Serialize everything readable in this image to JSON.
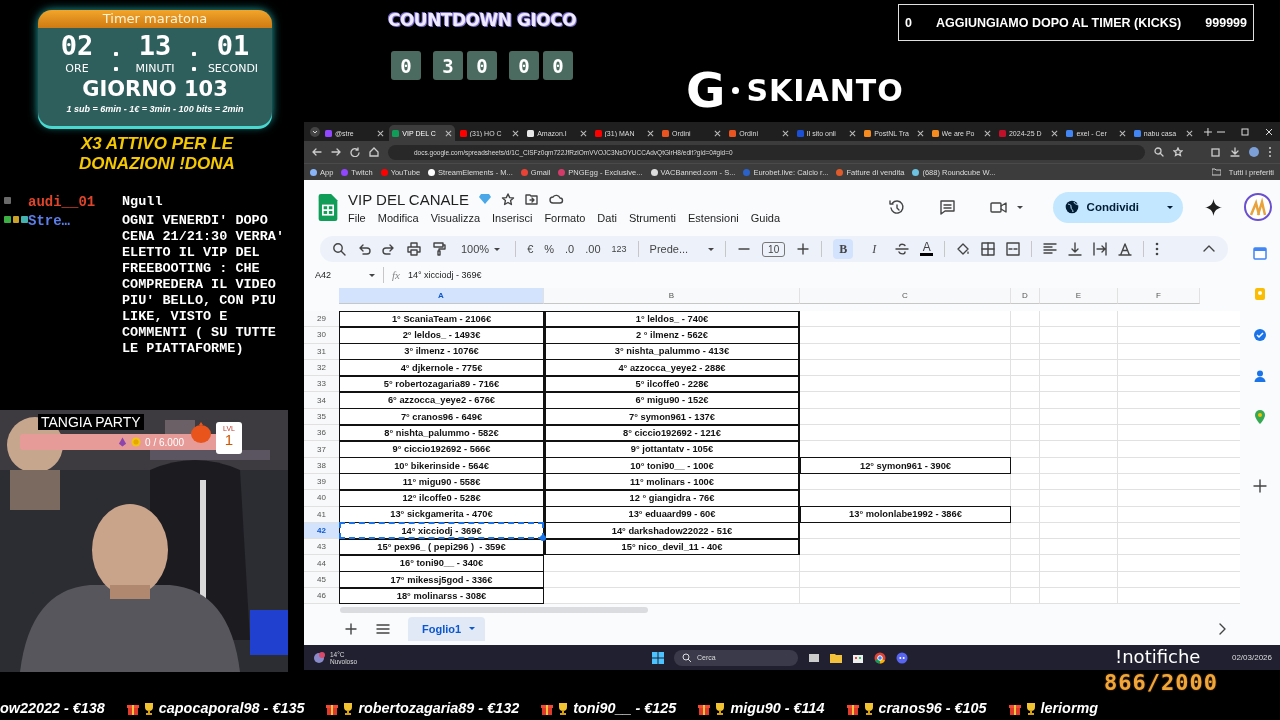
{
  "timer": {
    "title": "Timer maratona",
    "hours": "02",
    "minutes": "13",
    "seconds": "01",
    "labels": [
      "ORE",
      "MINUTI",
      "SECONDI"
    ],
    "day": "GIORNO 103",
    "rates": "1 sub = 6min - 1€ = 3min - 100 bits = 2min"
  },
  "promo": "X3 ATTIVO PER LE DONAZIONI !DONA",
  "chat": [
    {
      "user": "audi__01",
      "color": "#e0442a",
      "badges": [
        {
          "color": "#6a6a6a"
        }
      ],
      "message": "Ngull"
    },
    {
      "user": "Stre…",
      "color": "#5b7ee8",
      "badges": [
        {
          "color": "#3cb043"
        },
        {
          "color": "#c9a227"
        },
        {
          "color": "#44b3b0"
        }
      ],
      "message": "OGNI VENERDI' DOPO CENA 21/21:30 VERRA' ELETTO IL VIP DEL FREEBOOTING : CHE COMPREDERA IL VIDEO PIU' BELLO, CON PIU LIKE, VISTO E COMMENTI ( SU TUTTE LE PIATTAFORME)"
    }
  ],
  "tangia": {
    "title": "TANGIA PARTY",
    "progress": {
      "text": "0 / 6.000",
      "level": 0
    },
    "level_label": "LVL",
    "level_number": "1"
  },
  "countdown": {
    "title": "COUNTDOWN GIOCO",
    "groups": [
      [
        "0"
      ],
      [
        "3",
        "0"
      ],
      [
        "0",
        "0"
      ]
    ]
  },
  "logo": {
    "mark": "G",
    "name": "SKIANTO"
  },
  "kicks": {
    "count": "0",
    "label": "AGGIUNGIAMO DOPO AL TIMER (KICKS)",
    "limit": "999999"
  },
  "browser": {
    "tabs": [
      {
        "label": "@stre",
        "color": "#9146ff",
        "selected": false
      },
      {
        "label": "VIP DEL C",
        "color": "#0f9d58",
        "selected": true
      },
      {
        "label": "(31) HO C",
        "color": "#ff0000",
        "selected": false
      },
      {
        "label": "Amazon.I",
        "color": "#e8e8e8",
        "selected": false
      },
      {
        "label": "(31) MAN",
        "color": "#ff0000",
        "selected": false
      },
      {
        "label": "Ordini",
        "color": "#e95420",
        "selected": false
      },
      {
        "label": "Ordini",
        "color": "#e95420",
        "selected": false
      },
      {
        "label": "Il sito onli",
        "color": "#1a4fd6",
        "selected": false
      },
      {
        "label": "PostNL Tra",
        "color": "#f68b1f",
        "selected": false
      },
      {
        "label": "We are Po",
        "color": "#f68b1f",
        "selected": false
      },
      {
        "label": "2024-25 D",
        "color": "#c0102a",
        "selected": false
      },
      {
        "label": "exel - Cer",
        "color": "#4285f4",
        "selected": false
      },
      {
        "label": "nabu casa",
        "color": "#4285f4",
        "selected": false
      }
    ],
    "url": "docs.google.com/spreadsheets/d/1C_ClSFz0qm722JfRzlOmVVOJC3NsOYUCCAdvQtGlrH8/edit?gid=0#gid=0",
    "bookmarks": [
      {
        "label": "App",
        "color": "#8ab4f8"
      },
      {
        "label": "Twitch",
        "color": "#9146ff"
      },
      {
        "label": "YouTube",
        "color": "#ff0000"
      },
      {
        "label": "StreamElements - M...",
        "color": "#ffffff"
      },
      {
        "label": "Gmail",
        "color": "#ea4335"
      },
      {
        "label": "PNGEgg - Exclusive...",
        "color": "#d33b6b"
      },
      {
        "label": "VACBanned.com - S...",
        "color": "#dddddd"
      },
      {
        "label": "Eurobet.live: Calcio r...",
        "color": "#2a62c9"
      },
      {
        "label": "Fatture di vendita",
        "color": "#e05b2b"
      },
      {
        "label": "(688) Roundcube W...",
        "color": "#6cc2e0"
      }
    ],
    "all_bookmarks": "Tutti i preferiti"
  },
  "sheet": {
    "title": "VIP DEL CANALE",
    "menu": [
      "File",
      "Modifica",
      "Visualizza",
      "Inserisci",
      "Formato",
      "Dati",
      "Strumenti",
      "Estensioni",
      "Guida"
    ],
    "share": "Condividi",
    "toolbar": {
      "zoom": "100%",
      "currency": "€",
      "percent": "%",
      "decimal_less": ".0",
      "decimal_more": ".00",
      "number_format": "123",
      "font": "Prede...",
      "font_size": "10",
      "bold": {
        "label": "B",
        "selected": true
      },
      "italic": {
        "label": "I",
        "selected": false
      },
      "text_color": "A"
    },
    "cell_ref": "A42",
    "fx": "fx",
    "formula": "14° xicciodj - 369€",
    "columns": [
      {
        "label": "A",
        "selected": true
      },
      {
        "label": "B",
        "selected": false
      },
      {
        "label": "C",
        "selected": false
      },
      {
        "label": "D",
        "selected": false
      },
      {
        "label": "E",
        "selected": false
      },
      {
        "label": "F",
        "selected": false
      }
    ],
    "rows": [
      {
        "n": "29",
        "selected": false,
        "a": "1° ScaniaTeam - 2106€",
        "b": "1° leldos_ - 740€"
      },
      {
        "n": "30",
        "selected": false,
        "a": "2° leldos_ - 1493€",
        "b": "2 ° ilmenz - 562€"
      },
      {
        "n": "31",
        "selected": false,
        "a": "3° ilmenz - 1076€",
        "b": "3° nishta_palummo - 413€"
      },
      {
        "n": "32",
        "selected": false,
        "a": "4° djkernole - 775€",
        "b": "4° azzocca_yeye2 - 288€"
      },
      {
        "n": "33",
        "selected": false,
        "a": "5° robertozagaria89 - 716€",
        "b": "5° ilcoffe0 - 228€"
      },
      {
        "n": "34",
        "selected": false,
        "a": "6° azzocca_yeye2 - 676€",
        "b": "6° migu90 - 152€"
      },
      {
        "n": "35",
        "selected": false,
        "a": "7° cranos96 - 649€",
        "b": "7° symon961 - 137€"
      },
      {
        "n": "36",
        "selected": false,
        "a": "8° nishta_palummo - 582€",
        "b": "8° ciccio192692 - 121€"
      },
      {
        "n": "37",
        "selected": false,
        "a": "9° ciccio192692 - 566€",
        "b": "9° jottantatv - 105€"
      },
      {
        "n": "38",
        "selected": false,
        "a": "10° bikerinside - 564€",
        "b": "10° toni90__ - 100€",
        "c": "12° symon961 - 390€"
      },
      {
        "n": "39",
        "selected": false,
        "a": "11° migu90 - 558€",
        "b": "11° molinars - 100€"
      },
      {
        "n": "40",
        "selected": false,
        "a": "12° ilcoffe0 - 528€",
        "b": "12 ° giangidra - 76€"
      },
      {
        "n": "41",
        "selected": false,
        "a": "13° sickgamerita - 470€",
        "b": "13° eduaard99 - 60€",
        "c": "13° molonlabe1992 - 386€"
      },
      {
        "n": "42",
        "selected": true,
        "a": "14° xicciodj - 369€",
        "b": "14° darkshadow22022 - 51€"
      },
      {
        "n": "43",
        "selected": false,
        "a": "15° pex96_ ( pepi296 )  - 359€",
        "b": "15° nico_devil_11 - 40€"
      },
      {
        "n": "44",
        "selected": false,
        "a": "16° toni90__ - 340€"
      },
      {
        "n": "45",
        "selected": false,
        "a": "17° mikessj5god - 336€"
      },
      {
        "n": "46",
        "selected": false,
        "a": "18° molinarss - 308€"
      }
    ],
    "sheet_tabs": [
      {
        "label": "Foglio1",
        "selected": true
      }
    ]
  },
  "taskbar": {
    "temperature": "14°C",
    "weather": "Nuvoloso",
    "search": "Cerca",
    "date": "02/03/2026"
  },
  "notifications": "!notifiche",
  "goal": "866/2000",
  "ticker": [
    {
      "kind": "partial",
      "text": "ow22022 - €138"
    },
    {
      "kind": "entry",
      "text": "capocaporal98 - €135"
    },
    {
      "kind": "entry",
      "text": "robertozagaria89 - €132"
    },
    {
      "kind": "entry",
      "text": "toni90__ - €125"
    },
    {
      "kind": "entry",
      "text": "migu90 - €114"
    },
    {
      "kind": "entry",
      "text": "cranos96 - €105"
    },
    {
      "kind": "entry",
      "text": "leriormg"
    }
  ]
}
